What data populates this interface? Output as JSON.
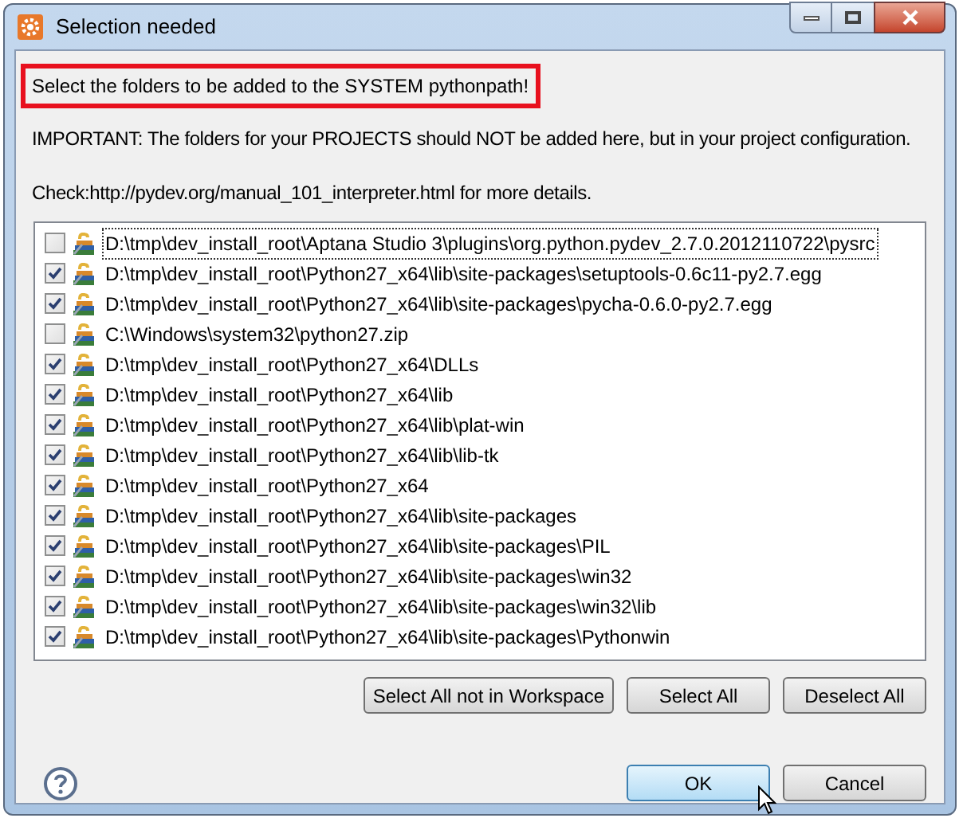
{
  "window": {
    "title": "Selection needed"
  },
  "heading": "Select the folders to be added to the SYSTEM pythonpath!",
  "notes": [
    "IMPORTANT: The folders for your PROJECTS should NOT be added here, but in your project configuration.",
    "Check:http://pydev.org/manual_101_interpreter.html for more details."
  ],
  "folders": [
    {
      "path": "D:\\tmp\\dev_install_root\\Aptana Studio 3\\plugins\\org.python.pydev_2.7.0.2012110722\\pysrc",
      "checked": false,
      "focused": true
    },
    {
      "path": "D:\\tmp\\dev_install_root\\Python27_x64\\lib\\site-packages\\setuptools-0.6c11-py2.7.egg",
      "checked": true,
      "focused": false
    },
    {
      "path": "D:\\tmp\\dev_install_root\\Python27_x64\\lib\\site-packages\\pycha-0.6.0-py2.7.egg",
      "checked": true,
      "focused": false
    },
    {
      "path": "C:\\Windows\\system32\\python27.zip",
      "checked": false,
      "focused": false
    },
    {
      "path": "D:\\tmp\\dev_install_root\\Python27_x64\\DLLs",
      "checked": true,
      "focused": false
    },
    {
      "path": "D:\\tmp\\dev_install_root\\Python27_x64\\lib",
      "checked": true,
      "focused": false
    },
    {
      "path": "D:\\tmp\\dev_install_root\\Python27_x64\\lib\\plat-win",
      "checked": true,
      "focused": false
    },
    {
      "path": "D:\\tmp\\dev_install_root\\Python27_x64\\lib\\lib-tk",
      "checked": true,
      "focused": false
    },
    {
      "path": "D:\\tmp\\dev_install_root\\Python27_x64",
      "checked": true,
      "focused": false
    },
    {
      "path": "D:\\tmp\\dev_install_root\\Python27_x64\\lib\\site-packages",
      "checked": true,
      "focused": false
    },
    {
      "path": "D:\\tmp\\dev_install_root\\Python27_x64\\lib\\site-packages\\PIL",
      "checked": true,
      "focused": false
    },
    {
      "path": "D:\\tmp\\dev_install_root\\Python27_x64\\lib\\site-packages\\win32",
      "checked": true,
      "focused": false
    },
    {
      "path": "D:\\tmp\\dev_install_root\\Python27_x64\\lib\\site-packages\\win32\\lib",
      "checked": true,
      "focused": false
    },
    {
      "path": "D:\\tmp\\dev_install_root\\Python27_x64\\lib\\site-packages\\Pythonwin",
      "checked": true,
      "focused": false
    }
  ],
  "selection_buttons": [
    "Select All not in Workspace",
    "Select All",
    "Deselect All"
  ],
  "dialog_buttons": [
    {
      "label": "OK",
      "default": true
    },
    {
      "label": "Cancel",
      "default": false
    }
  ]
}
